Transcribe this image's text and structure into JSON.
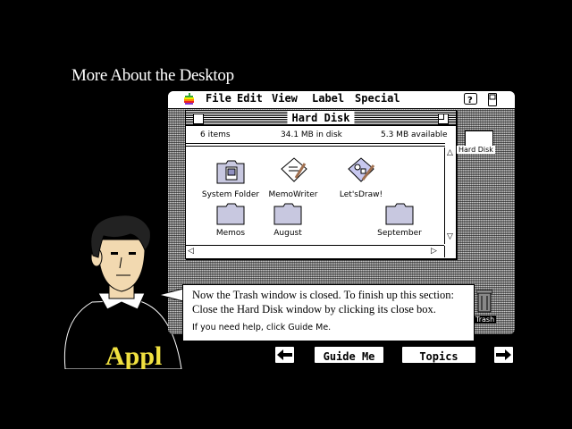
{
  "page_title": "More About the Desktop",
  "menubar": {
    "items": [
      "File",
      "Edit",
      "View",
      "Label",
      "Special"
    ],
    "right_icons": [
      "help-icon",
      "application-menu-icon"
    ]
  },
  "window": {
    "title": "Hard Disk",
    "info": {
      "items": "6 items",
      "in_disk": "34.1 MB in disk",
      "available": "5.3 MB available"
    },
    "icons": [
      {
        "label": "System Folder",
        "icon": "system-folder-icon"
      },
      {
        "label": "MemoWriter",
        "icon": "memowriter-app-icon"
      },
      {
        "label": "Let'sDraw!",
        "icon": "letsdraw-app-icon"
      },
      {
        "label": "Memos",
        "icon": "folder-icon"
      },
      {
        "label": "August",
        "icon": "folder-icon"
      },
      {
        "label": "September",
        "icon": "folder-icon"
      }
    ]
  },
  "desktop_icons": {
    "hard_disk": "Hard Disk",
    "trash": "Trash"
  },
  "message": {
    "line1": "Now the Trash window is closed. To finish up this section:",
    "line2": "Close the Hard Disk window by clicking its close box.",
    "help": "If you need help, click Guide Me."
  },
  "nav": {
    "guide_me": "Guide Me",
    "topics": "Topics",
    "back": "back-arrow-icon",
    "forward": "forward-arrow-icon"
  },
  "presenter_shirt_text": "Appl"
}
